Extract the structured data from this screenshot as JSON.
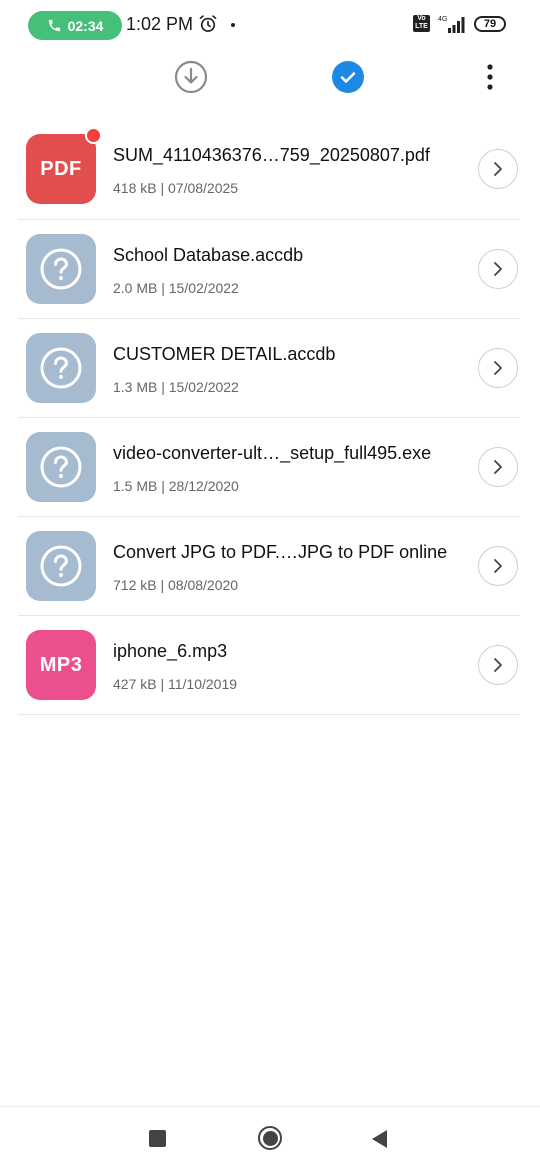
{
  "status_bar": {
    "call_timer": "02:34",
    "time": "1:02 PM",
    "network_badge": "Vo LTE",
    "network_type": "4G",
    "battery": "79",
    "icons": [
      "phone-icon",
      "alarm-icon",
      "signal-icon",
      "battery-icon"
    ]
  },
  "toolbar": {
    "icons": [
      "download-icon",
      "check-circle-icon",
      "more-vertical-icon"
    ],
    "accent": "#1e88e5"
  },
  "files": [
    {
      "icon_label": "PDF",
      "type": "pdf",
      "color": "#e24d4d",
      "name": "SUM_4110436376…759_20250807.pdf",
      "meta": "418 kB | 07/08/2025",
      "unread": true
    },
    {
      "icon_label": "",
      "type": "unknown",
      "color": "#a6bad0",
      "name": "School Database.accdb",
      "meta": "2.0 MB | 15/02/2022",
      "unread": false
    },
    {
      "icon_label": "",
      "type": "unknown",
      "color": "#a6bad0",
      "name": "CUSTOMER DETAIL.accdb",
      "meta": "1.3 MB | 15/02/2022",
      "unread": false
    },
    {
      "icon_label": "",
      "type": "unknown",
      "color": "#a6bad0",
      "name": "video-converter-ult…_setup_full495.exe",
      "meta": "1.5 MB | 28/12/2020",
      "unread": false
    },
    {
      "icon_label": "",
      "type": "unknown",
      "color": "#a6bad0",
      "name": "Convert JPG to PDF.…JPG to PDF online",
      "meta": "712 kB | 08/08/2020",
      "unread": false
    },
    {
      "icon_label": "MP3",
      "type": "mp3",
      "color": "#ec4f8d",
      "name": "iphone_6.mp3",
      "meta": "427 kB | 11/10/2019",
      "unread": false
    }
  ],
  "nav_bar": {
    "icons": [
      "recents-icon",
      "home-icon",
      "back-icon"
    ]
  }
}
